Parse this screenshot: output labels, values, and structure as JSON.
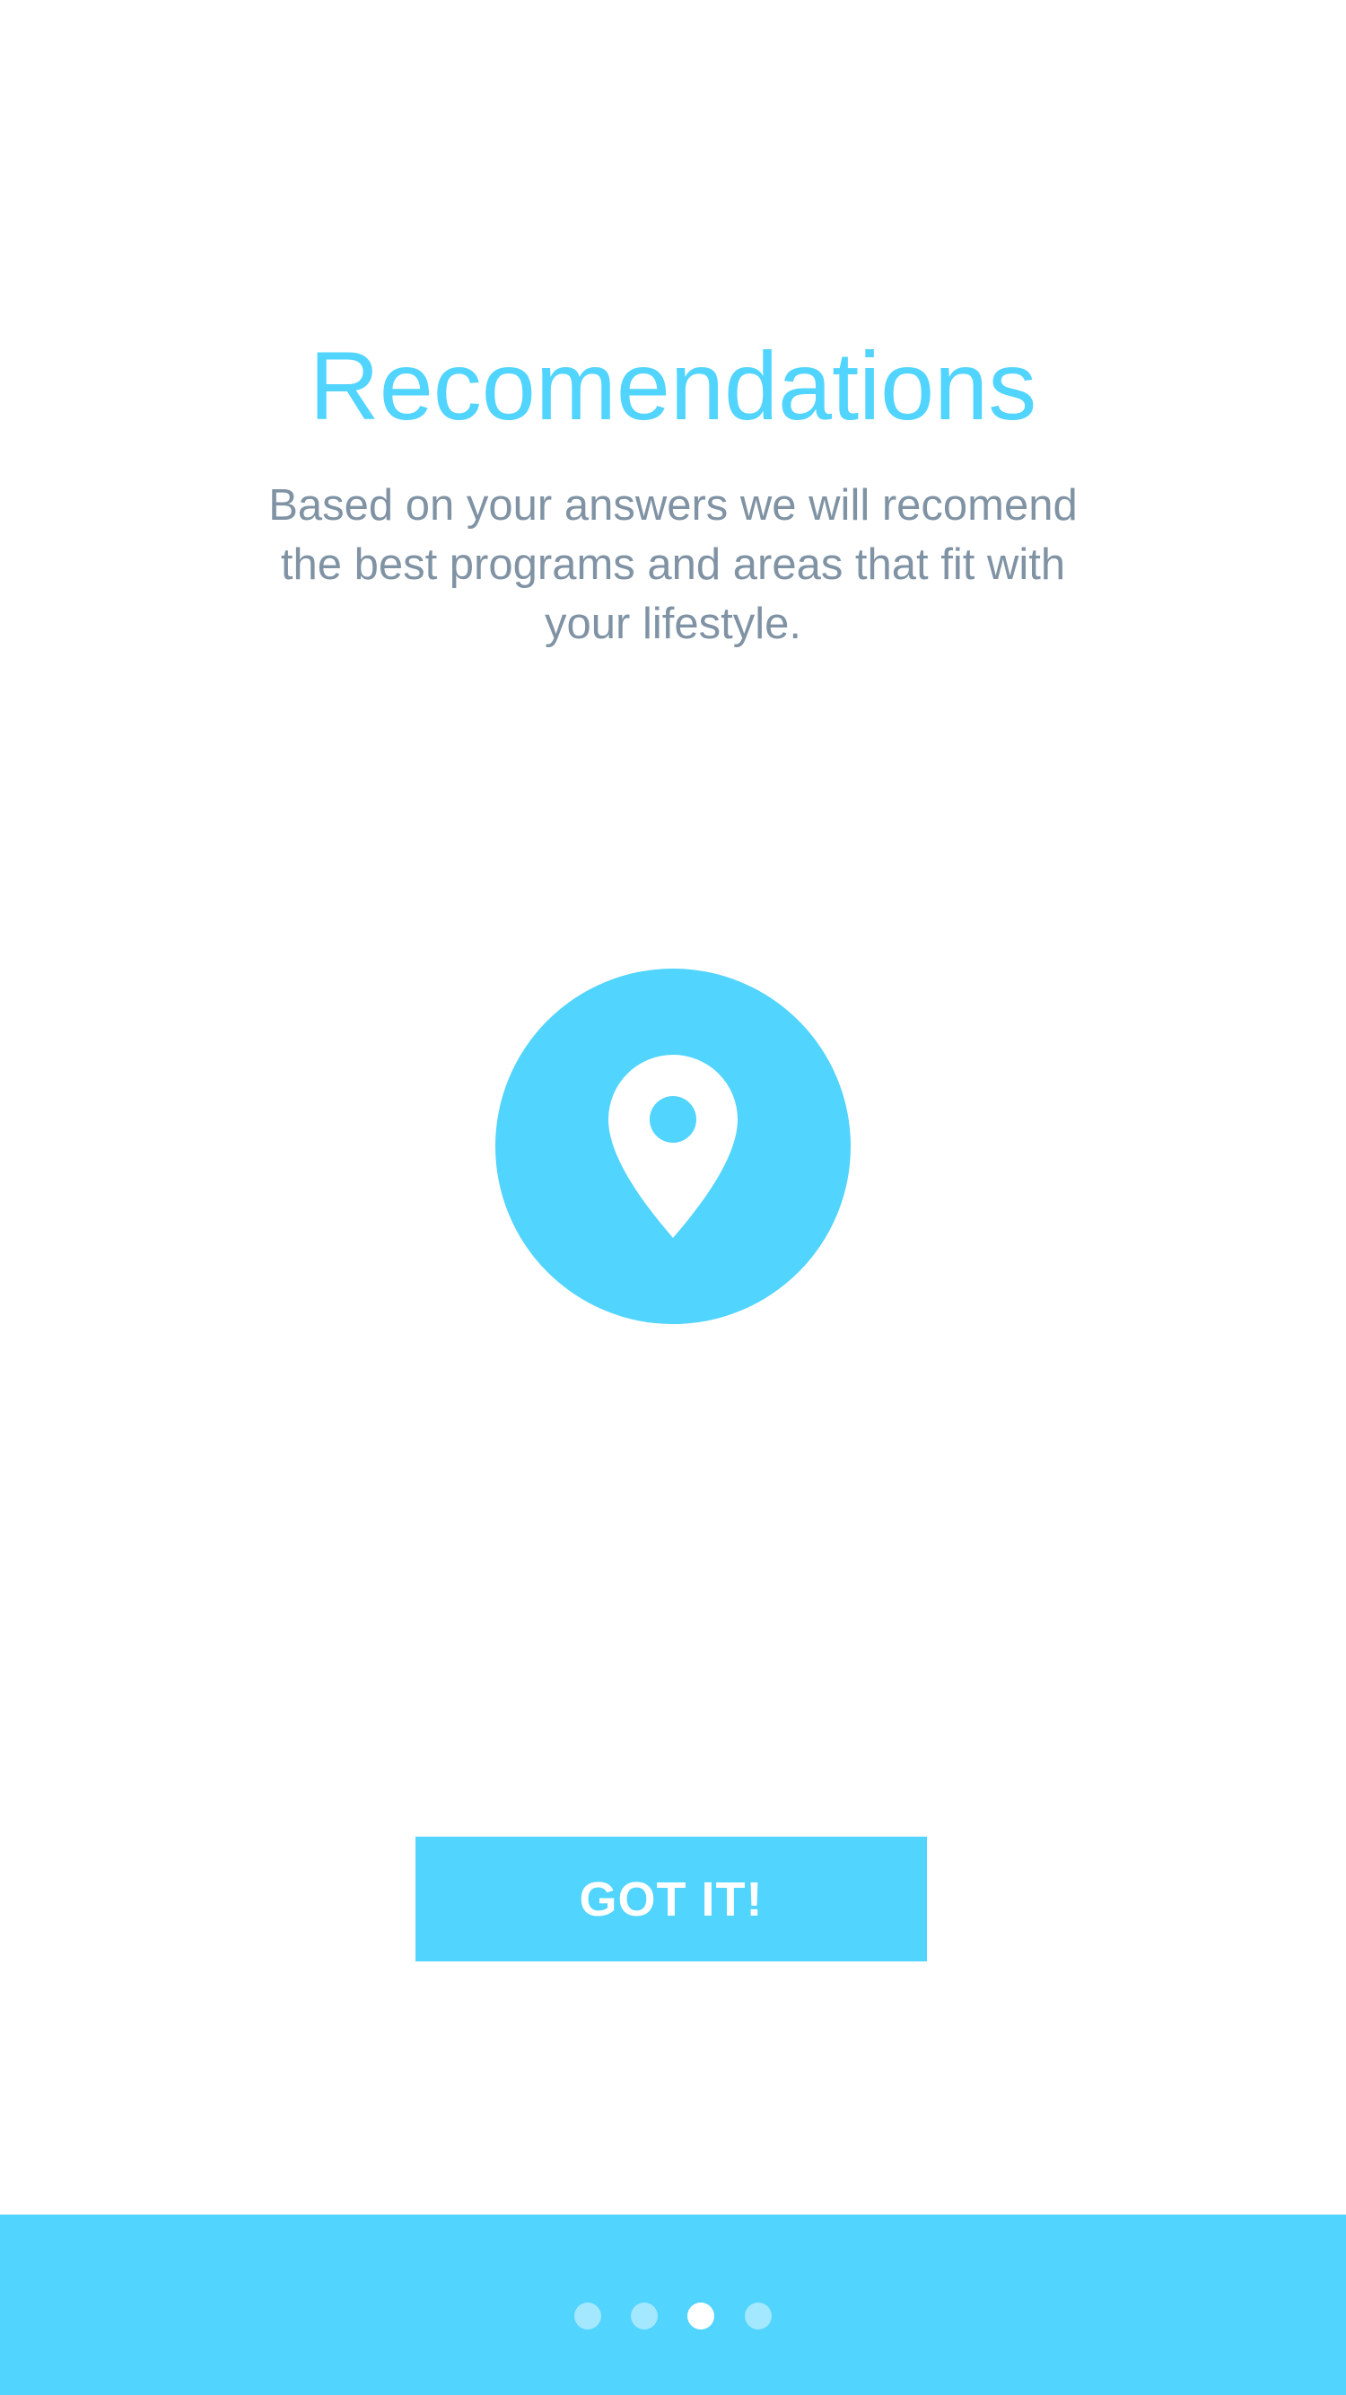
{
  "onboarding": {
    "title": "Recomendations",
    "description": "Based on your answers we will recomend the best programs and areas that fit with your lifestyle.",
    "icon": "map-pin-icon",
    "button_label": "GOT IT!",
    "pagination": {
      "total_pages": 4,
      "current_page": 3
    }
  },
  "colors": {
    "accent": "#51d4fe",
    "text_secondary": "#8093a4",
    "dot_inactive": "#a3e8fe",
    "dot_active": "#ffffff",
    "background": "#ffffff"
  }
}
